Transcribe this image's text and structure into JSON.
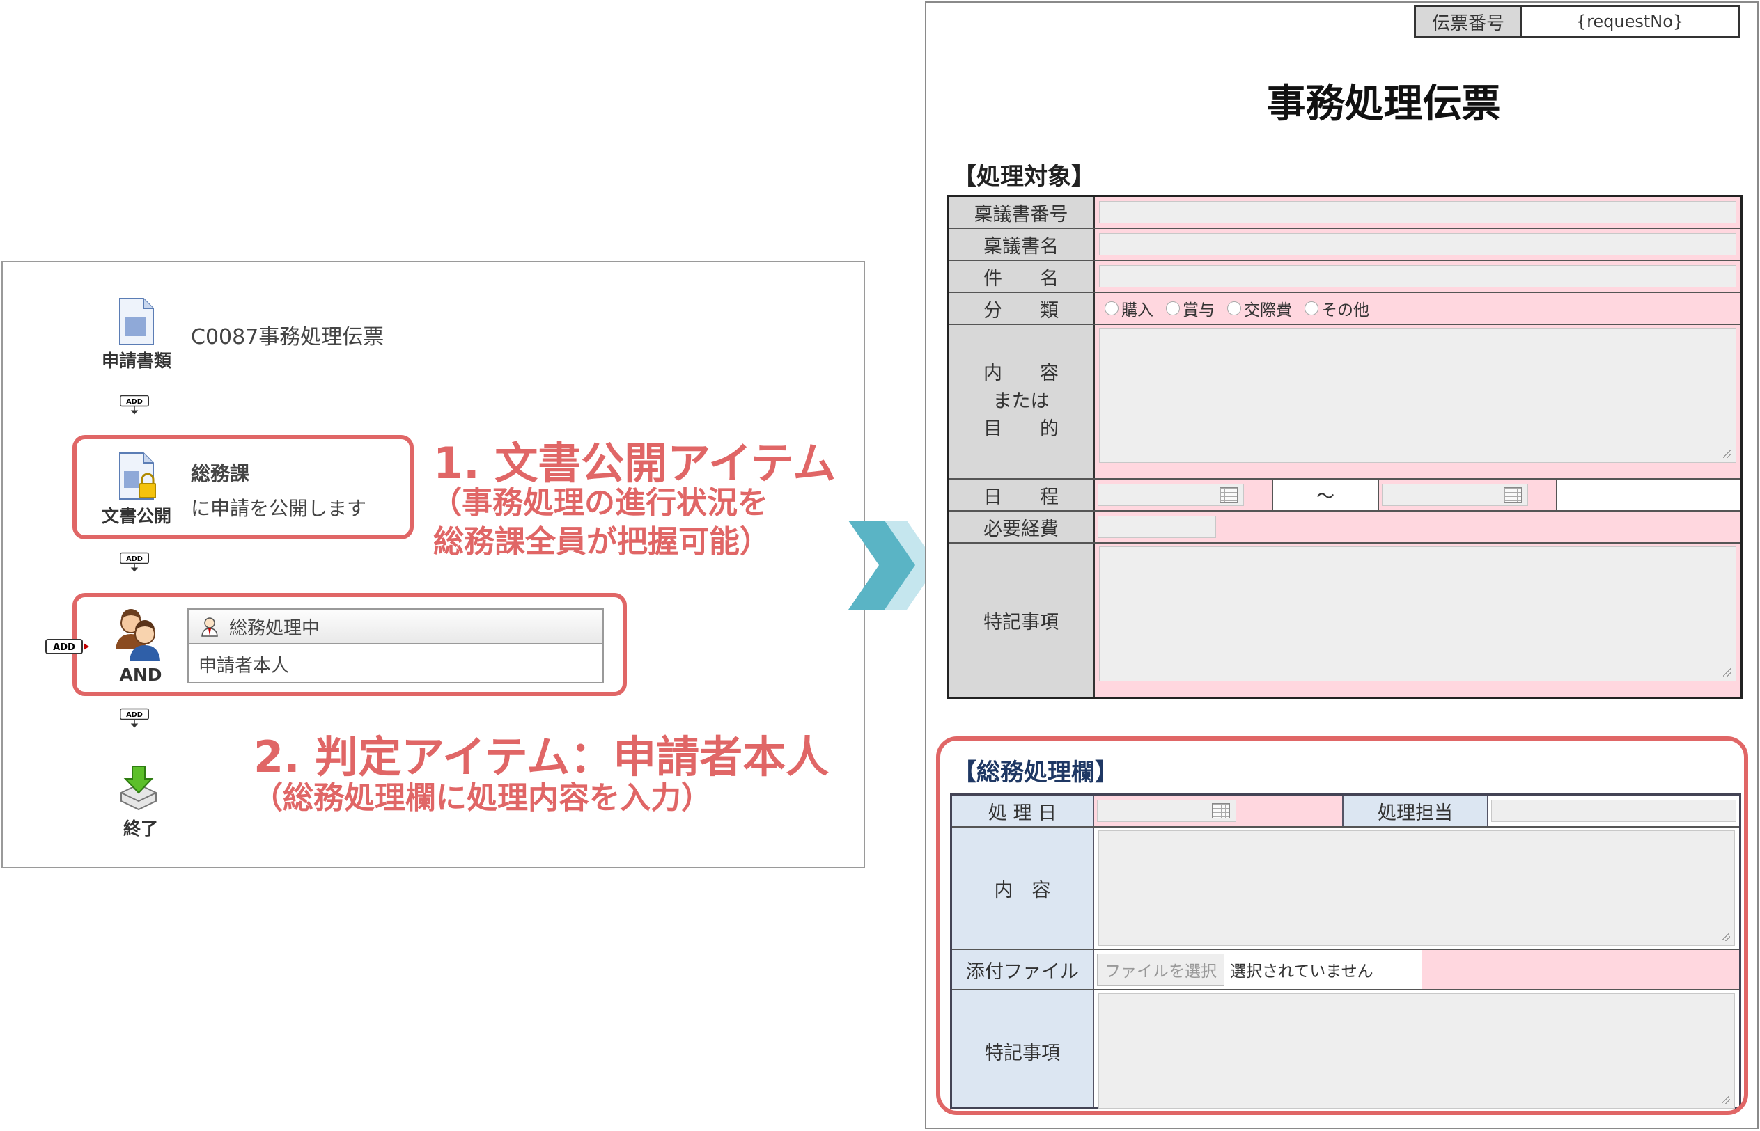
{
  "workflow": {
    "application_form": {
      "label": "申請書類",
      "form_name": "C0087事務処理伝票"
    },
    "add_badge": "ADD",
    "publish_item": {
      "label": "文書公開",
      "department": "総務課",
      "description": "に申請を公開します"
    },
    "judge_item": {
      "label": "AND",
      "step_name": "総務処理中",
      "assignee": "申請者本人"
    },
    "end_item": {
      "label": "終了"
    }
  },
  "annotations": {
    "one": {
      "title": "1. 文書公開アイテム",
      "line1": "（事務処理の進行状況を",
      "line2": "総務課全員が把握可能）"
    },
    "two": {
      "title": "2. 判定アイテム：申請者本人",
      "line1": "（総務処理欄に処理内容を入力）"
    }
  },
  "colors": {
    "highlight": "#e06666",
    "required_field": "#ffd7df",
    "arrow": "#5ab4c5"
  },
  "form": {
    "slip_number_label": "伝票番号",
    "slip_number_value": "{requestNo}",
    "title": "事務処理伝票",
    "target_section": {
      "heading": "【処理対象】",
      "ringi_no": "稟議書番号",
      "ringi_name": "稟議書名",
      "subject": "件　　名",
      "category": "分　　類",
      "category_options": [
        "購入",
        "賞与",
        "交際費",
        "その他"
      ],
      "content_l1": "内　　容",
      "content_l2": "または",
      "content_l3": "目　　的",
      "schedule": "日　　程",
      "schedule_sep": "～",
      "expense": "必要経費",
      "notes": "特記事項"
    },
    "general_section": {
      "heading": "【総務処理欄】",
      "process_date": "処 理 日",
      "handler": "処理担当",
      "content": "内　容",
      "attachment": "添付ファイル",
      "file_button": "ファイルを選択",
      "file_status": "選択されていません",
      "notes": "特記事項"
    }
  }
}
